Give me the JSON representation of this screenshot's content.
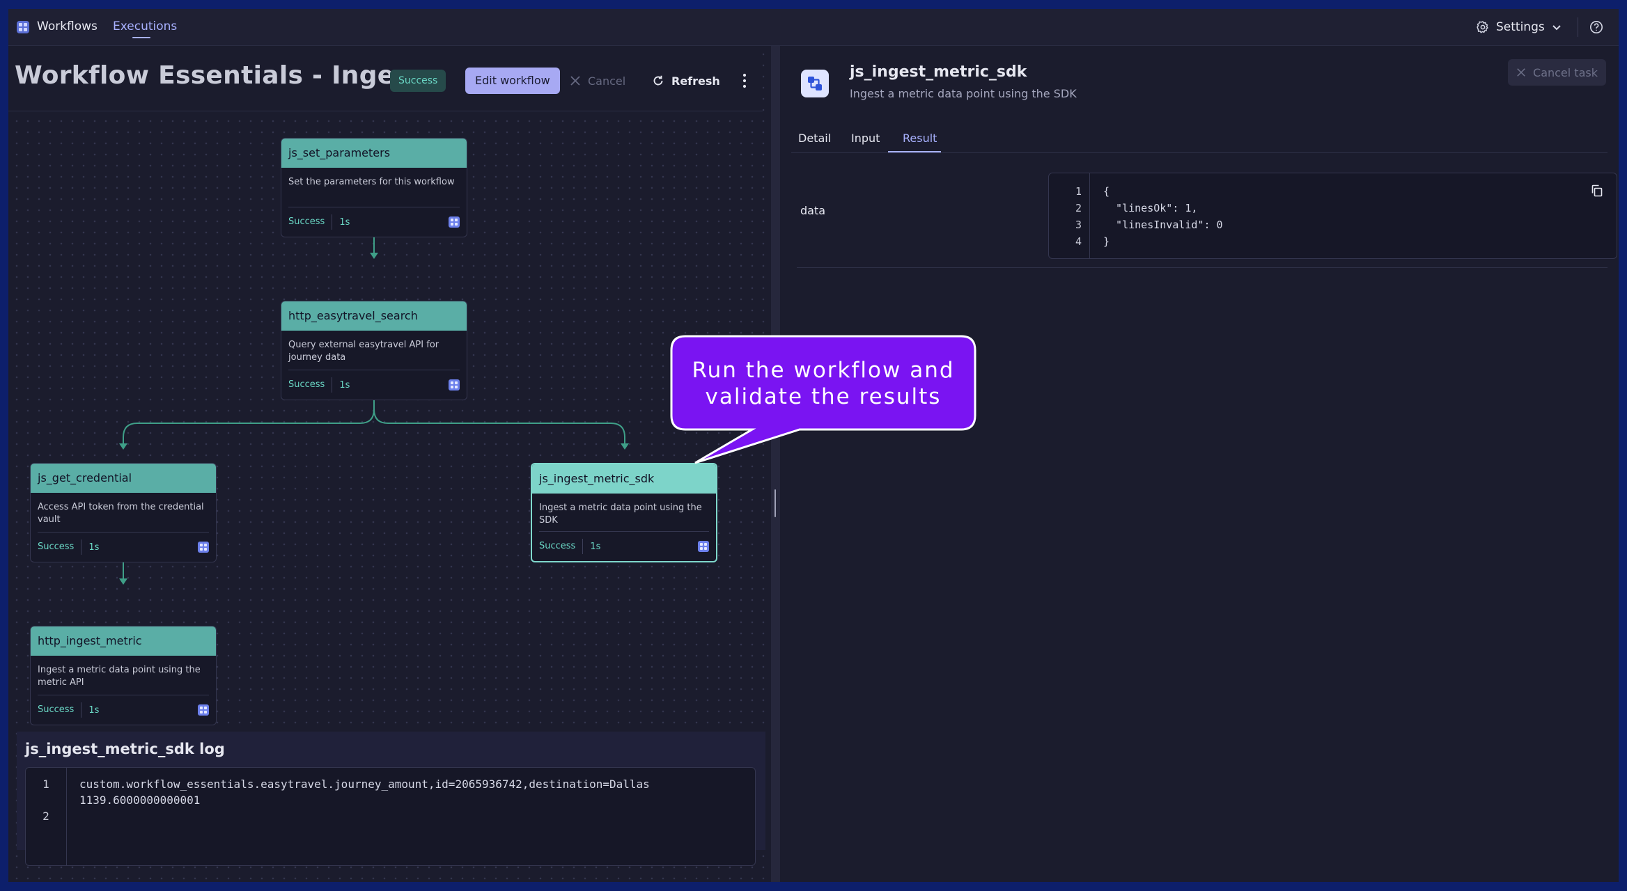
{
  "topbar": {
    "workflows_label": "Workflows",
    "executions_label": "Executions",
    "settings_label": "Settings"
  },
  "header": {
    "title": "Workflow Essentials - Inges…",
    "status_badge": "Success",
    "edit_label": "Edit workflow",
    "cancel_label": "Cancel",
    "refresh_label": "Refresh"
  },
  "nodes": [
    {
      "name": "js_set_parameters",
      "desc": "Set the parameters for this workflow",
      "status": "Success",
      "time": "1s"
    },
    {
      "name": "http_easytravel_search",
      "desc": "Query external easytravel API for journey data",
      "status": "Success",
      "time": "1s"
    },
    {
      "name": "js_get_credential",
      "desc": "Access API token from the credential vault",
      "status": "Success",
      "time": "1s"
    },
    {
      "name": "js_ingest_metric_sdk",
      "desc": "Ingest a metric data point using the SDK",
      "status": "Success",
      "time": "1s"
    },
    {
      "name": "http_ingest_metric",
      "desc": "Ingest a metric data point using the metric API",
      "status": "Success",
      "time": "1s"
    }
  ],
  "log": {
    "title": "js_ingest_metric_sdk log",
    "line_numbers": [
      "1",
      "2"
    ],
    "lines": [
      "custom.workflow_essentials.easytravel.journey_amount,id=2065936742,destination=Dallas",
      "1139.6000000000001"
    ]
  },
  "task": {
    "title": "js_ingest_metric_sdk",
    "subtitle": "Ingest a metric data point using the SDK",
    "cancel_task_label": "Cancel task",
    "tabs": [
      "Detail",
      "Input",
      "Result"
    ],
    "active_tab": "Result",
    "data_label": "data",
    "json_line_numbers": [
      "1",
      "2",
      "3",
      "4"
    ],
    "json_lines": [
      "{",
      "  \"linesOk\": 1,",
      "  \"linesInvalid\": 0",
      "}"
    ]
  },
  "callout": {
    "line1": "Run the workflow and",
    "line2": "validate the results",
    "color": "#7a14f2"
  },
  "colors": {
    "accent": "#a8b1ff",
    "success": "#6ad7c5",
    "node_header": "#5aaea6",
    "background": "#1b1c2d"
  }
}
